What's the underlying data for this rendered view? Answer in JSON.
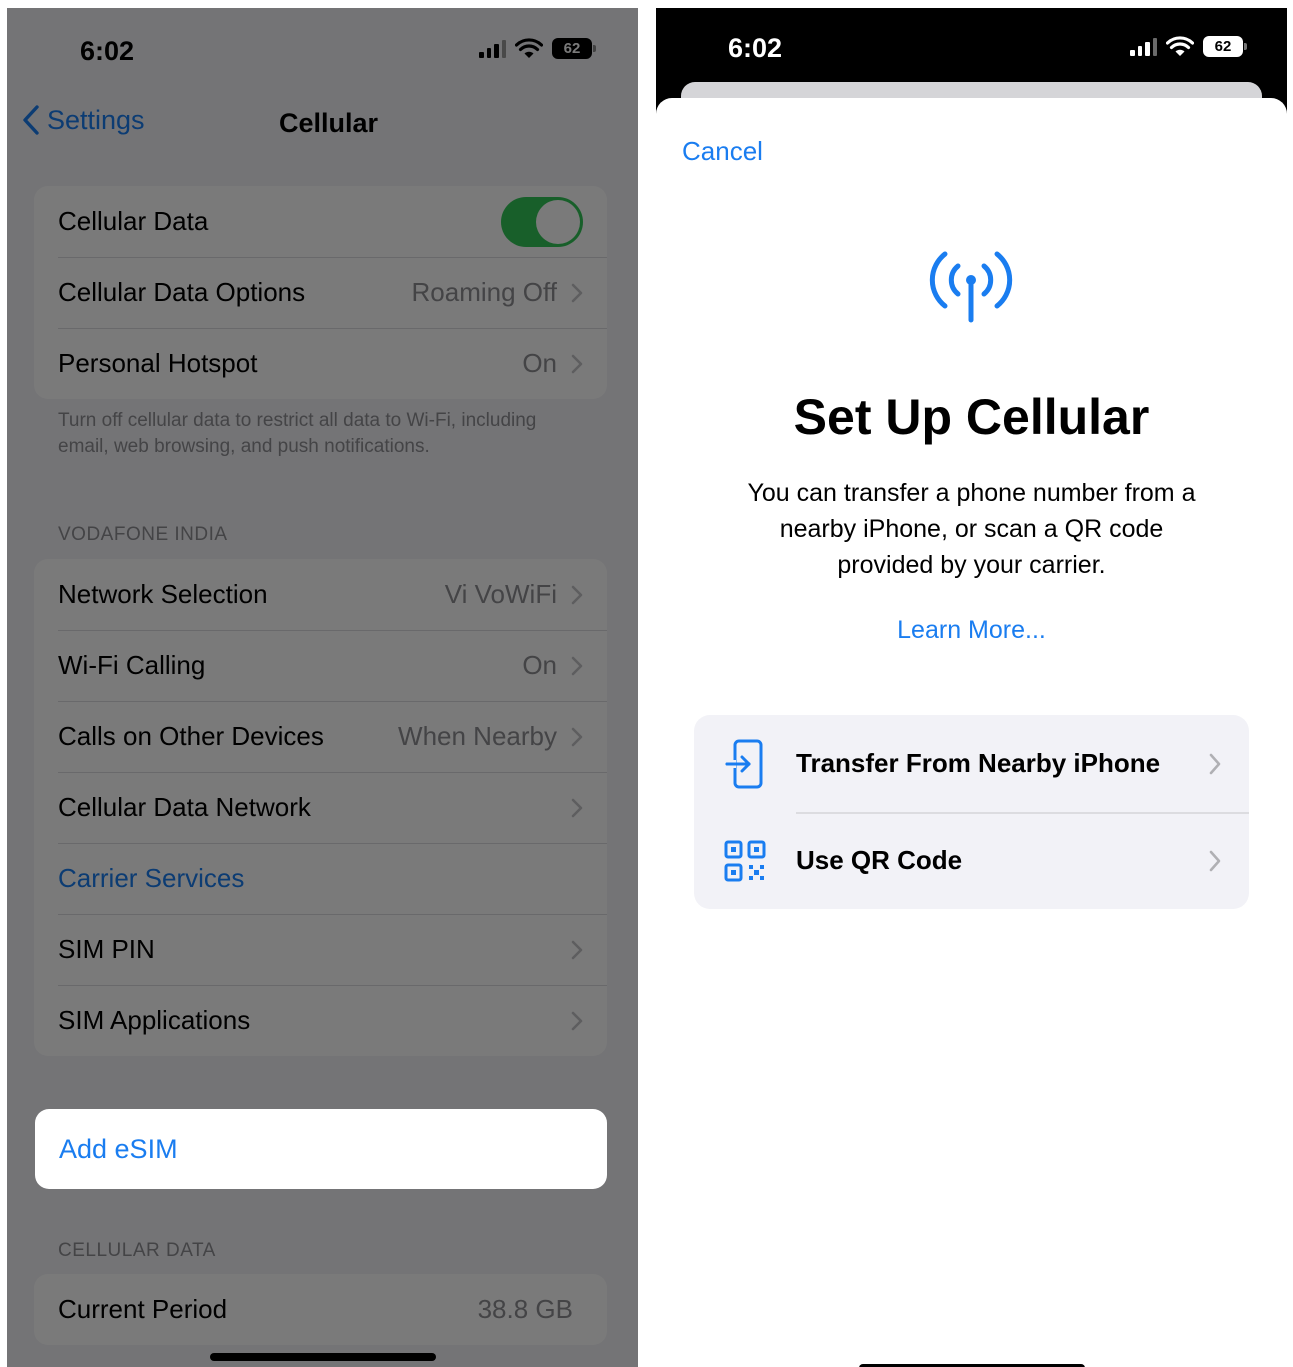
{
  "left": {
    "status": {
      "time": "6:02",
      "battery": "62"
    },
    "nav": {
      "back_label": "Settings",
      "title": "Cellular"
    },
    "group1": {
      "cellular_data": "Cellular Data",
      "data_options": {
        "label": "Cellular Data Options",
        "value": "Roaming Off"
      },
      "hotspot": {
        "label": "Personal Hotspot",
        "value": "On"
      }
    },
    "footnote": "Turn off cellular data to restrict all data to Wi-Fi, including email, web browsing, and push notifications.",
    "carrier_header": "VODAFONE INDIA",
    "group2": {
      "network": {
        "label": "Network Selection",
        "value": "Vi VoWiFi"
      },
      "wifi_calling": {
        "label": "Wi-Fi Calling",
        "value": "On"
      },
      "other_devices": {
        "label": "Calls on Other Devices",
        "value": "When Nearby"
      },
      "data_network": {
        "label": "Cellular Data Network"
      },
      "carrier_services": {
        "label": "Carrier Services"
      },
      "sim_pin": {
        "label": "SIM PIN"
      },
      "sim_apps": {
        "label": "SIM Applications"
      }
    },
    "add_esim": "Add eSIM",
    "usage_header": "CELLULAR DATA",
    "current_period": {
      "label": "Current Period",
      "value": "38.8 GB"
    }
  },
  "right": {
    "status": {
      "time": "6:02",
      "battery": "62"
    },
    "cancel": "Cancel",
    "title": "Set Up Cellular",
    "description": "You can transfer a phone number from a nearby iPhone, or scan a QR code provided by your carrier.",
    "learn_more": "Learn More...",
    "options": [
      {
        "label": "Transfer From Nearby iPhone",
        "icon": "transfer-icon"
      },
      {
        "label": "Use QR Code",
        "icon": "qr-code-icon"
      }
    ]
  },
  "colors": {
    "accent": "#1a7df0",
    "toggle_on": "#34c759"
  }
}
